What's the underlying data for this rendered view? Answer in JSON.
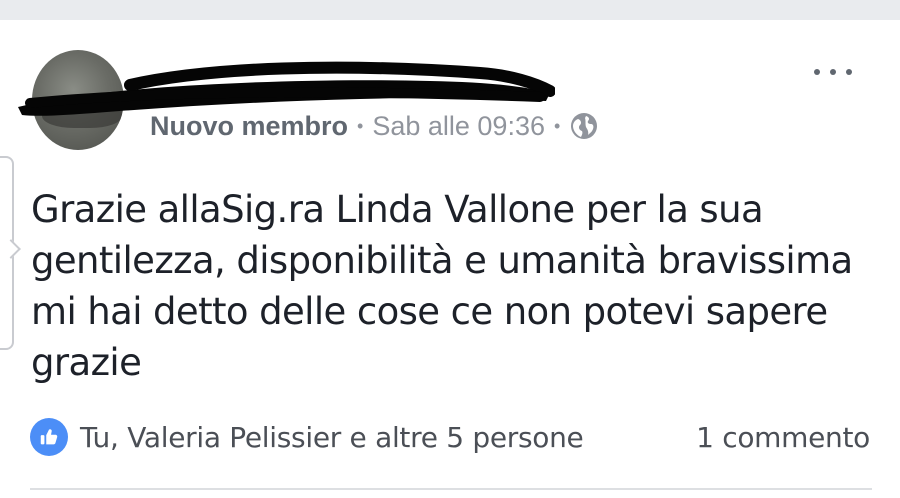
{
  "post": {
    "author": {
      "role": "Nuovo membro",
      "timestamp": "Sab alle 09:36",
      "privacy_icon": "globe-icon"
    },
    "separator": "•",
    "text": "Grazie allaSig.ra Linda Vallone  per la sua\ngentilezza, disponibilità e umanità bravissima\nmi hai detto delle cose ce non potevi sapere\ngrazie",
    "reactions": {
      "icon": "like-icon",
      "summary": "Tu, Valeria Pelissier e altre 5 persone"
    },
    "comments": {
      "count_label": "1 commento"
    },
    "menu_icon": "more-options-icon"
  },
  "colors": {
    "like_blue": "#4c8ef7",
    "text": "#1d2129",
    "meta": "#90949c",
    "background_strip": "#e9ebee"
  }
}
